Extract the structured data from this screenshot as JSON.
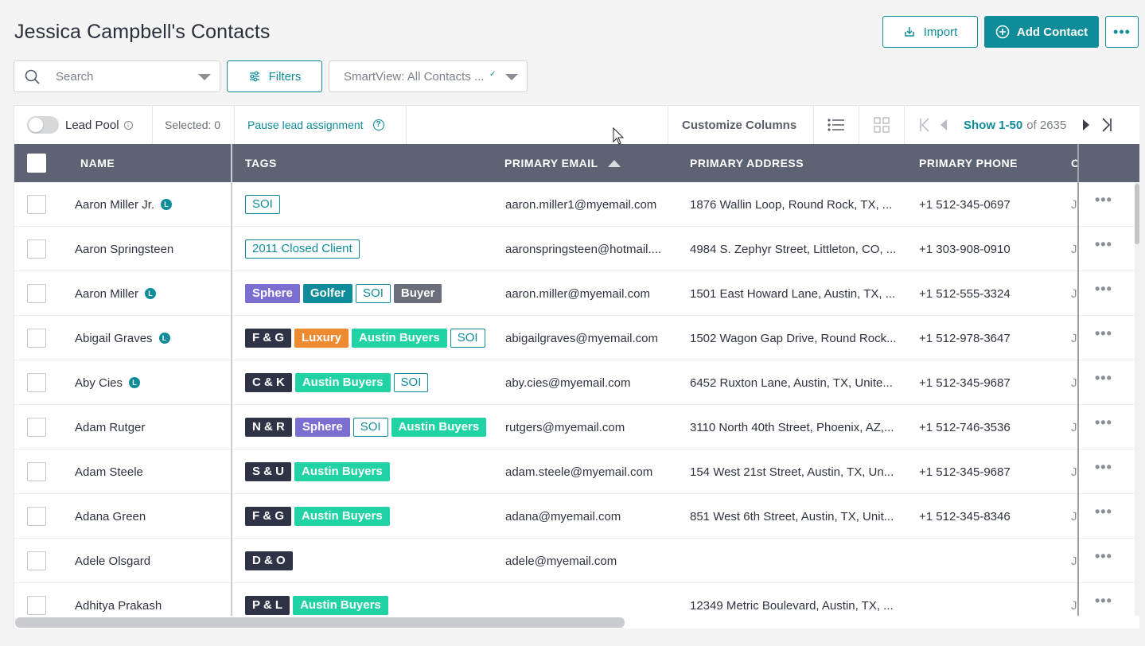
{
  "page_title": "Jessica Campbell's Contacts",
  "header": {
    "import_label": "Import",
    "add_contact_label": "Add Contact",
    "more_label": "•••"
  },
  "search": {
    "placeholder": "Search"
  },
  "filters_label": "Filters",
  "smartview": {
    "label": "SmartView: All Contacts ..."
  },
  "toolbar": {
    "lead_pool_label": "Lead Pool",
    "selected_label": "Selected: 0",
    "pause_label": "Pause lead assignment",
    "customize_label": "Customize Columns",
    "pagination_range": "Show 1-50",
    "pagination_total": "of 2635"
  },
  "columns": {
    "name": "NAME",
    "tags": "TAGS",
    "email": "PRIMARY EMAIL",
    "address": "PRIMARY ADDRESS",
    "phone": "PRIMARY PHONE",
    "owner": "O"
  },
  "colors": {
    "accent": "#0f8c99",
    "header_bg": "#5e6373",
    "tag_purple": "#7a6fd1",
    "tag_green": "#20d2a4",
    "tag_orange": "#ee8a2f",
    "tag_navy": "#2e3446"
  },
  "rows": [
    {
      "name": "Aaron Miller Jr.",
      "lead": true,
      "tags": [
        {
          "t": "SOI",
          "s": "outline"
        }
      ],
      "email": "aaron.miller1@myemail.com",
      "address": "1876 Wallin Loop, Round Rock, TX, ...",
      "phone": "+1 512-345-0697",
      "owner": "Je"
    },
    {
      "name": "Aaron Springsteen",
      "lead": false,
      "tags": [
        {
          "t": "2011 Closed Client",
          "s": "outline"
        }
      ],
      "email": "aaronspringsteen@hotmail....",
      "address": "4984 S. Zephyr Street, Littleton, CO, ...",
      "phone": "+1 303-908-0910",
      "owner": "Je"
    },
    {
      "name": "Aaron Miller",
      "lead": true,
      "tags": [
        {
          "t": "Sphere",
          "s": "purple"
        },
        {
          "t": "Golfer",
          "s": "teal"
        },
        {
          "t": "SOI",
          "s": "outline"
        },
        {
          "t": "Buyer",
          "s": "gray"
        }
      ],
      "email": "aaron.miller@myemail.com",
      "address": "1501 East Howard Lane, Austin, TX, ...",
      "phone": "+1 512-555-3324",
      "owner": "Je"
    },
    {
      "name": "Abigail Graves",
      "lead": true,
      "tags": [
        {
          "t": "F & G",
          "s": "navy"
        },
        {
          "t": "Luxury",
          "s": "orange"
        },
        {
          "t": "Austin Buyers",
          "s": "green"
        },
        {
          "t": "SOI",
          "s": "outline"
        }
      ],
      "email": "abigailgraves@myemail.com",
      "address": "1502 Wagon Gap Drive, Round Rock...",
      "phone": "+1 512-978-3647",
      "owner": "Je"
    },
    {
      "name": "Aby Cies",
      "lead": true,
      "tags": [
        {
          "t": "C & K",
          "s": "navy"
        },
        {
          "t": "Austin Buyers",
          "s": "green"
        },
        {
          "t": "SOI",
          "s": "outline"
        }
      ],
      "email": "aby.cies@myemail.com",
      "address": "6452 Ruxton Lane, Austin, TX, Unite...",
      "phone": "+1 512-345-9687",
      "owner": "Je"
    },
    {
      "name": "Adam Rutger",
      "lead": false,
      "tags": [
        {
          "t": "N & R",
          "s": "navy"
        },
        {
          "t": "Sphere",
          "s": "purple"
        },
        {
          "t": "SOI",
          "s": "outline"
        },
        {
          "t": "Austin Buyers",
          "s": "green"
        }
      ],
      "email": "rutgers@myemail.com",
      "address": "3110 North 40th Street, Phoenix, AZ,...",
      "phone": "+1 512-746-3536",
      "owner": "Je"
    },
    {
      "name": "Adam Steele",
      "lead": false,
      "tags": [
        {
          "t": "S & U",
          "s": "navy"
        },
        {
          "t": "Austin Buyers",
          "s": "green"
        }
      ],
      "email": "adam.steele@myemail.com",
      "address": "154 West 21st Street, Austin, TX, Un...",
      "phone": "+1 512-345-9687",
      "owner": "Je"
    },
    {
      "name": "Adana Green",
      "lead": false,
      "tags": [
        {
          "t": "F & G",
          "s": "navy"
        },
        {
          "t": "Austin Buyers",
          "s": "green"
        }
      ],
      "email": "adana@myemail.com",
      "address": "851 West 6th Street, Austin, TX, Unit...",
      "phone": "+1 512-345-8346",
      "owner": "Je"
    },
    {
      "name": "Adele Olsgard",
      "lead": false,
      "tags": [
        {
          "t": "D & O",
          "s": "navy"
        }
      ],
      "email": "adele@myemail.com",
      "address": "",
      "phone": "",
      "owner": "Je"
    },
    {
      "name": "Adhitya Prakash",
      "lead": false,
      "tags": [
        {
          "t": "P & L",
          "s": "navy"
        },
        {
          "t": "Austin Buyers",
          "s": "green"
        }
      ],
      "email": "",
      "address": "12349 Metric Boulevard, Austin, TX, ...",
      "phone": "",
      "owner": "Je"
    }
  ]
}
